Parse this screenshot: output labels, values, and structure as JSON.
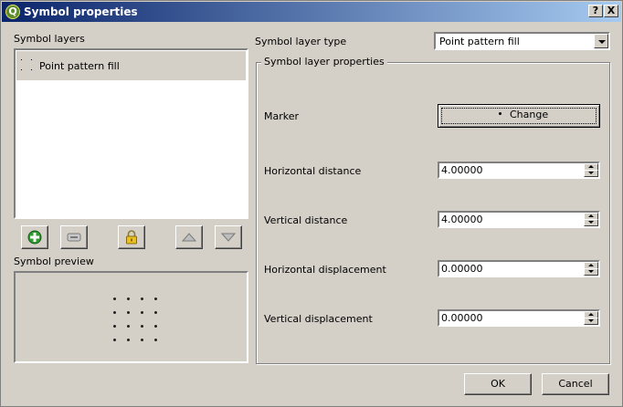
{
  "window": {
    "title": "Symbol properties",
    "help_label": "?",
    "close_label": "X"
  },
  "left": {
    "layers_label": "Symbol layers",
    "layers": [
      {
        "label": "Point pattern fill",
        "selected": true
      }
    ],
    "toolbar": {
      "add_icon": "plus-circle-icon",
      "remove_icon": "minus-icon",
      "lock_icon": "lock-icon",
      "up_icon": "arrow-up-icon",
      "down_icon": "arrow-down-icon"
    },
    "preview_label": "Symbol preview"
  },
  "right": {
    "layer_type_label": "Symbol layer type",
    "layer_type_value": "Point pattern fill",
    "group_label": "Symbol layer properties",
    "marker_label": "Marker",
    "change_label": "Change",
    "fields": [
      {
        "label": "Horizontal distance",
        "value": "4.00000"
      },
      {
        "label": "Vertical distance",
        "value": "4.00000"
      },
      {
        "label": "Horizontal displacement",
        "value": "0.00000"
      },
      {
        "label": "Vertical displacement",
        "value": "0.00000"
      }
    ]
  },
  "buttons": {
    "ok": "OK",
    "cancel": "Cancel"
  },
  "colors": {
    "titlebar_start": "#0a246a",
    "titlebar_end": "#a6caf0",
    "dialog_bg": "#d4d0c8"
  }
}
